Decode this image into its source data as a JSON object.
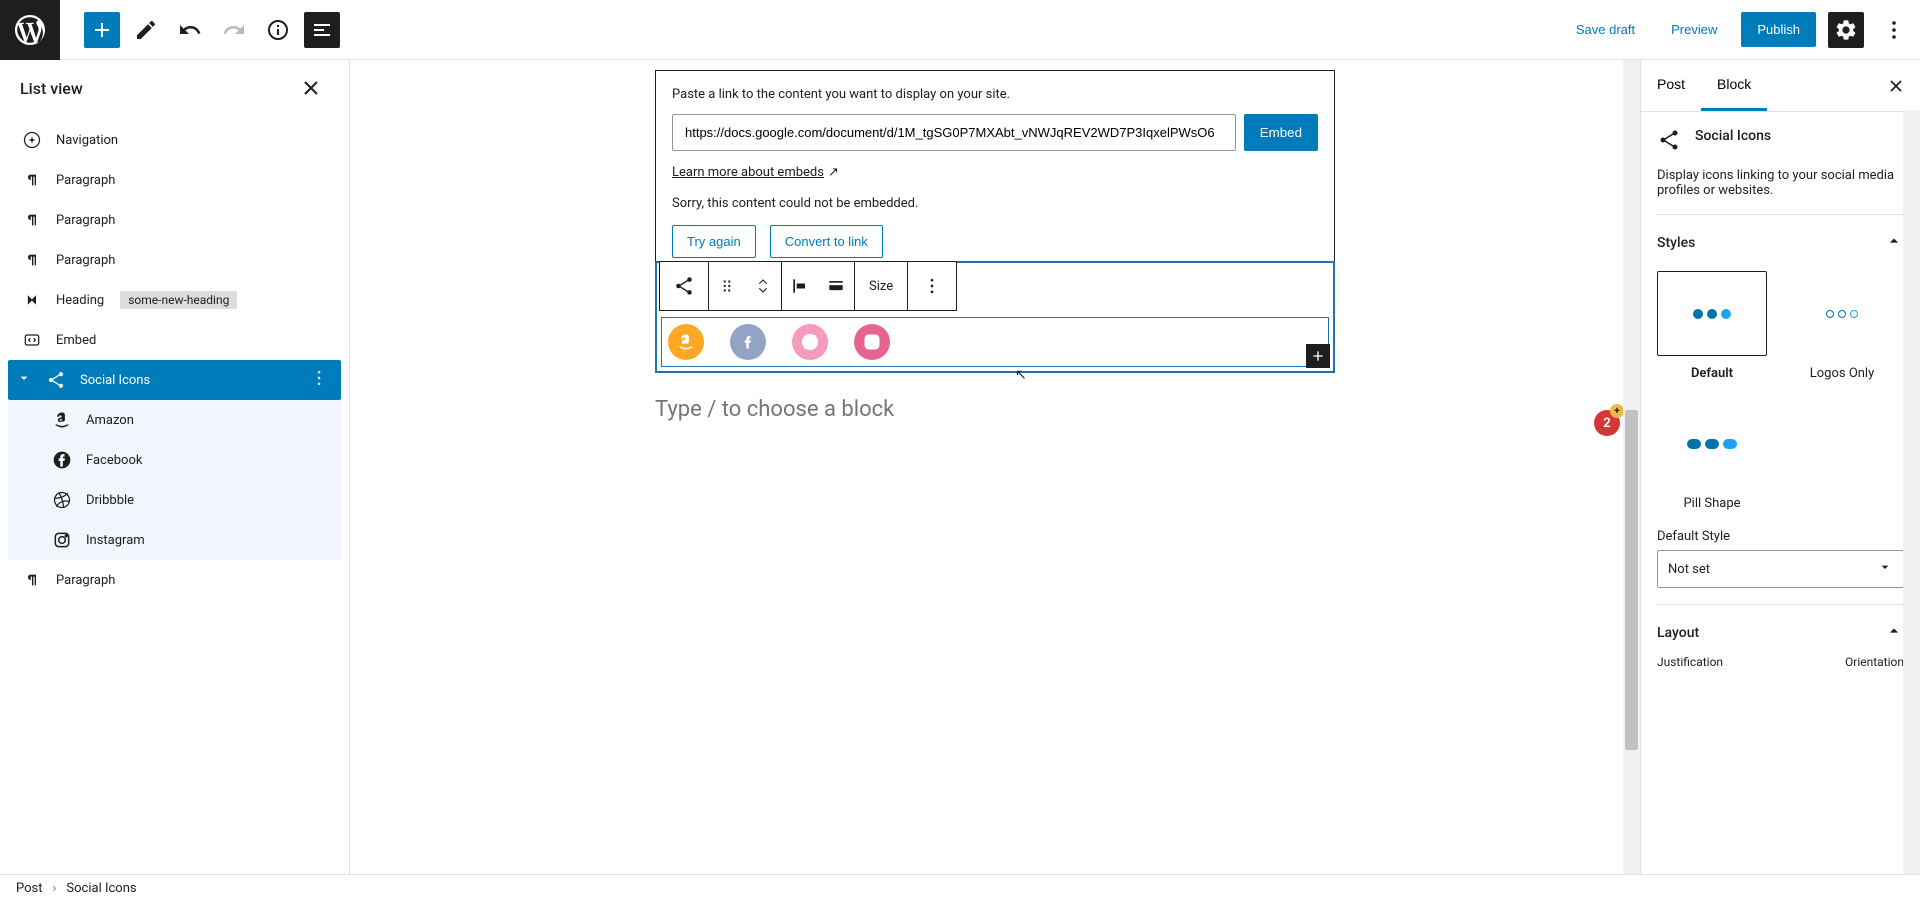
{
  "topBar": {
    "saveDraft": "Save draft",
    "preview": "Preview",
    "publish": "Publish"
  },
  "listView": {
    "title": "List view",
    "items": [
      {
        "label": "Navigation",
        "icon": "navigation"
      },
      {
        "label": "Paragraph",
        "icon": "paragraph"
      },
      {
        "label": "Paragraph",
        "icon": "paragraph"
      },
      {
        "label": "Paragraph",
        "icon": "paragraph"
      },
      {
        "label": "Heading",
        "icon": "heading",
        "badge": "some-new-heading"
      },
      {
        "label": "Embed",
        "icon": "embed"
      },
      {
        "label": "Social Icons",
        "icon": "share",
        "selected": true
      },
      {
        "label": "Amazon",
        "icon": "amazon",
        "child": true
      },
      {
        "label": "Facebook",
        "icon": "facebook",
        "child": true
      },
      {
        "label": "Dribbble",
        "icon": "dribbble",
        "child": true
      },
      {
        "label": "Instagram",
        "icon": "instagram",
        "child": true
      },
      {
        "label": "Paragraph",
        "icon": "paragraph"
      }
    ]
  },
  "canvas": {
    "embedDesc": "Paste a link to the content you want to display on your site.",
    "embedValue": "https://docs.google.com/document/d/1M_tgSG0P7MXAbt_vNWJqREV2WD7P3IqxelPWsO6",
    "embedButton": "Embed",
    "learnMore": "Learn more about embeds",
    "errorMsg": "Sorry, this content could not be embedded.",
    "tryAgain": "Try again",
    "convert": "Convert to link",
    "sizeLabel": "Size",
    "placeholder": "Type / to choose a block",
    "notifCount": "2"
  },
  "settings": {
    "tabs": {
      "post": "Post",
      "block": "Block"
    },
    "blockTitle": "Social Icons",
    "blockDesc": "Display icons linking to your social media profiles or websites.",
    "stylesTitle": "Styles",
    "styles": [
      {
        "label": "Default"
      },
      {
        "label": "Logos Only"
      },
      {
        "label": "Pill Shape"
      }
    ],
    "defaultStyleLabel": "Default Style",
    "defaultStyleValue": "Not set",
    "layoutTitle": "Layout",
    "justification": "Justification",
    "orientation": "Orientation"
  },
  "footer": {
    "crumb1": "Post",
    "crumb2": "Social Icons"
  }
}
